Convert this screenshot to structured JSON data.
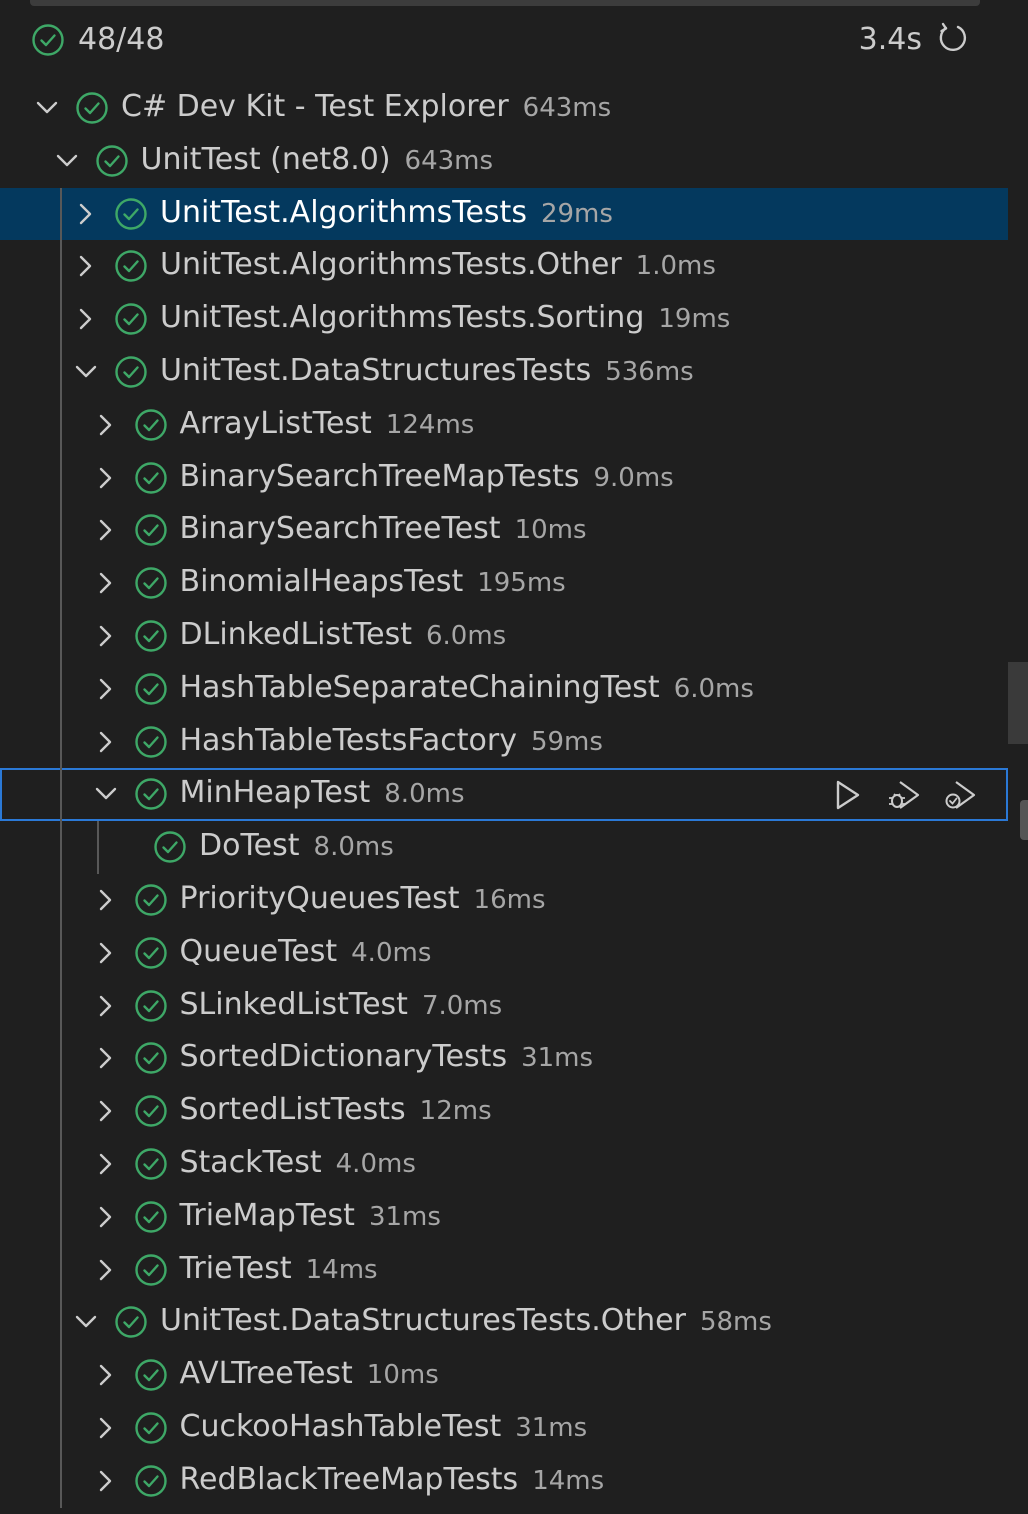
{
  "summary": {
    "count": "48/48",
    "duration": "3.4s"
  },
  "colors": {
    "pass": "#3ea867",
    "selection": "#04395e",
    "focus": "#2b79d6"
  },
  "icons": {
    "status": "check-circle-icon",
    "refresh": "refresh-icon",
    "run": "play-icon",
    "debug": "debug-icon",
    "coverage": "run-coverage-icon"
  },
  "tree": [
    {
      "label": "C# Dev Kit - Test Explorer",
      "duration": "643ms",
      "depth": 0,
      "expand": "open"
    },
    {
      "label": "UnitTest (net8.0)",
      "duration": "643ms",
      "depth": 1,
      "expand": "open"
    },
    {
      "label": "UnitTest.AlgorithmsTests",
      "duration": "29ms",
      "depth": 2,
      "expand": "closed",
      "selected": true
    },
    {
      "label": "UnitTest.AlgorithmsTests.Other",
      "duration": "1.0ms",
      "depth": 2,
      "expand": "closed"
    },
    {
      "label": "UnitTest.AlgorithmsTests.Sorting",
      "duration": "19ms",
      "depth": 2,
      "expand": "closed"
    },
    {
      "label": "UnitTest.DataStructuresTests",
      "duration": "536ms",
      "depth": 2,
      "expand": "open"
    },
    {
      "label": "ArrayListTest",
      "duration": "124ms",
      "depth": 3,
      "expand": "closed"
    },
    {
      "label": "BinarySearchTreeMapTests",
      "duration": "9.0ms",
      "depth": 3,
      "expand": "closed"
    },
    {
      "label": "BinarySearchTreeTest",
      "duration": "10ms",
      "depth": 3,
      "expand": "closed"
    },
    {
      "label": "BinomialHeapsTest",
      "duration": "195ms",
      "depth": 3,
      "expand": "closed"
    },
    {
      "label": "DLinkedListTest",
      "duration": "6.0ms",
      "depth": 3,
      "expand": "closed"
    },
    {
      "label": "HashTableSeparateChainingTest",
      "duration": "6.0ms",
      "depth": 3,
      "expand": "closed"
    },
    {
      "label": "HashTableTestsFactory",
      "duration": "59ms",
      "depth": 3,
      "expand": "closed"
    },
    {
      "label": "MinHeapTest",
      "duration": "8.0ms",
      "depth": 3,
      "expand": "open",
      "focused": true
    },
    {
      "label": "DoTest",
      "duration": "8.0ms",
      "depth": 4,
      "expand": "none"
    },
    {
      "label": "PriorityQueuesTest",
      "duration": "16ms",
      "depth": 3,
      "expand": "closed"
    },
    {
      "label": "QueueTest",
      "duration": "4.0ms",
      "depth": 3,
      "expand": "closed"
    },
    {
      "label": "SLinkedListTest",
      "duration": "7.0ms",
      "depth": 3,
      "expand": "closed"
    },
    {
      "label": "SortedDictionaryTests",
      "duration": "31ms",
      "depth": 3,
      "expand": "closed"
    },
    {
      "label": "SortedListTests",
      "duration": "12ms",
      "depth": 3,
      "expand": "closed"
    },
    {
      "label": "StackTest",
      "duration": "4.0ms",
      "depth": 3,
      "expand": "closed"
    },
    {
      "label": "TrieMapTest",
      "duration": "31ms",
      "depth": 3,
      "expand": "closed"
    },
    {
      "label": "TrieTest",
      "duration": "14ms",
      "depth": 3,
      "expand": "closed"
    },
    {
      "label": "UnitTest.DataStructuresTests.Other",
      "duration": "58ms",
      "depth": 2,
      "expand": "open"
    },
    {
      "label": "AVLTreeTest",
      "duration": "10ms",
      "depth": 3,
      "expand": "closed"
    },
    {
      "label": "CuckooHashTableTest",
      "duration": "31ms",
      "depth": 3,
      "expand": "closed"
    },
    {
      "label": "RedBlackTreeMapTests",
      "duration": "14ms",
      "depth": 3,
      "expand": "closed"
    }
  ]
}
